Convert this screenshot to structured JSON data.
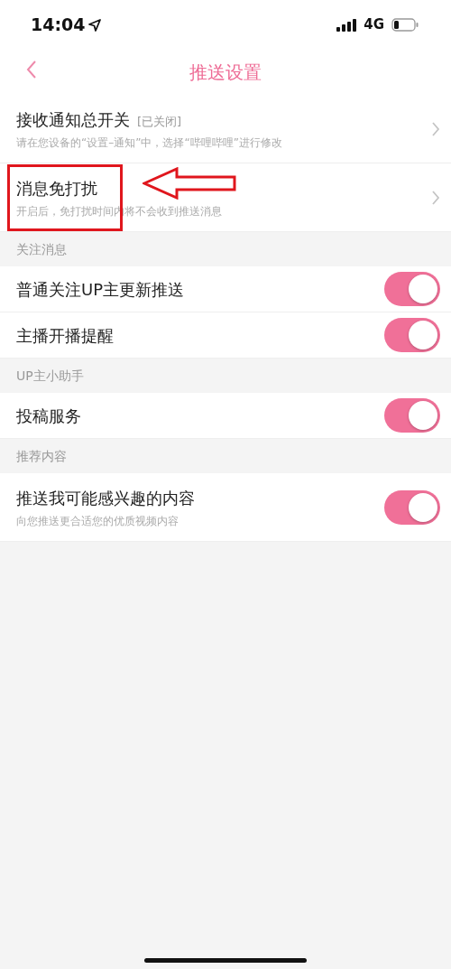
{
  "status_bar": {
    "time": "14:04",
    "network": "4G"
  },
  "nav": {
    "title": "推送设置"
  },
  "sections": [
    {
      "rows": [
        {
          "kind": "link",
          "title": "接收通知总开关",
          "tag": "[已关闭]",
          "subtitle": "请在您设备的“设置–通知”中，选择“哔哩哔哩”进行修改"
        },
        {
          "kind": "link",
          "title": "消息免打扰",
          "subtitle": "开启后，免打扰时间内将不会收到推送消息",
          "highlighted": true,
          "pointer_arrow": true
        }
      ]
    },
    {
      "header": "关注消息",
      "rows": [
        {
          "kind": "toggle",
          "title": "普通关注UP主更新推送",
          "on": true
        },
        {
          "kind": "toggle",
          "title": "主播开播提醒",
          "on": true
        }
      ]
    },
    {
      "header": "UP主小助手",
      "rows": [
        {
          "kind": "toggle",
          "title": "投稿服务",
          "on": true
        }
      ]
    },
    {
      "header": "推荐内容",
      "rows": [
        {
          "kind": "toggle",
          "title": "推送我可能感兴趣的内容",
          "subtitle": "向您推送更合适您的优质视频内容",
          "on": true
        }
      ]
    }
  ]
}
